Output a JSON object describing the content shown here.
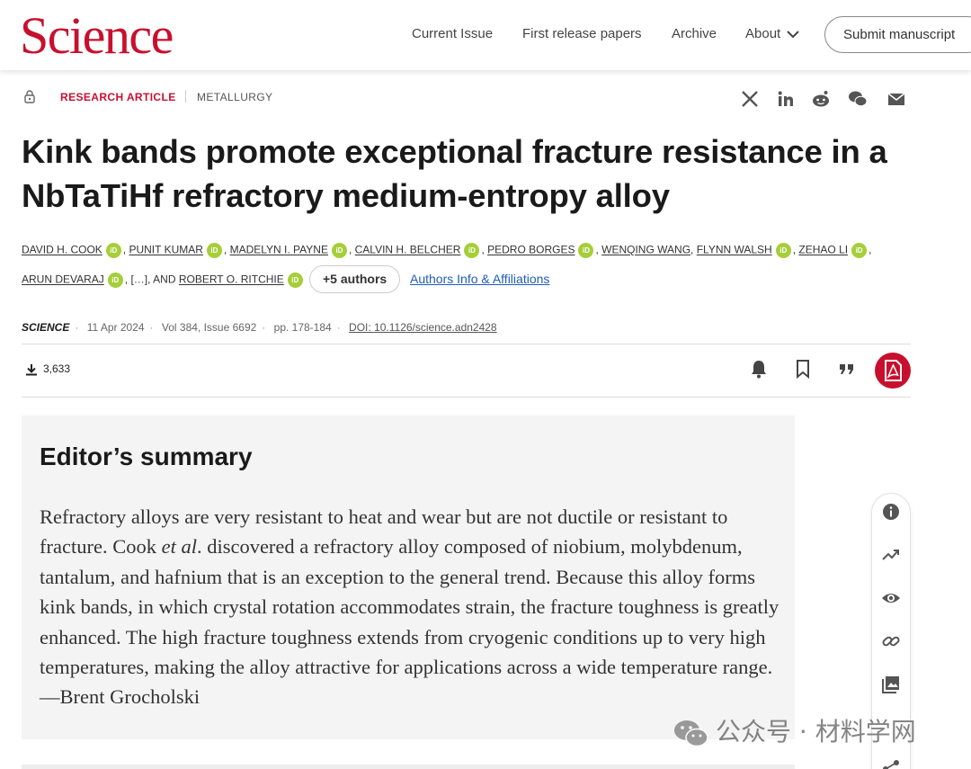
{
  "header": {
    "logo": "Science",
    "nav": [
      "Current Issue",
      "First release papers",
      "Archive",
      "About"
    ],
    "submit_label": "Submit manuscript"
  },
  "article": {
    "type": "RESEARCH ARTICLE",
    "subject": "METALLURGY",
    "title": "Kink bands promote exceptional fracture resistance in a NbTaTiHf refractory medium-entropy alloy",
    "authors_line1": [
      "DAVID H. COOK",
      "PUNIT KUMAR",
      "MADELYN I. PAYNE",
      "CALVIN H. BELCHER",
      "PEDRO BORGES",
      "WENQING WANG",
      "FLYNN WALSH",
      "ZEHAO LI"
    ],
    "authors_line2_first": "ARUN DEVARAJ",
    "authors_ellipsis": "[…], AND",
    "authors_last": "ROBERT O. RITCHIE",
    "orcid_label": "iD",
    "more_authors": "+5 authors",
    "affiliations_link": "Authors Info & Affiliations",
    "journal": "SCIENCE",
    "date": "11 Apr 2024",
    "volume": "Vol 384, Issue 6692",
    "pages": "pp. 178-184",
    "doi": "DOI: 10.1126/science.adn2428",
    "downloads": "3,633"
  },
  "summary": {
    "heading": "Editor’s summary",
    "text_before_italic": "Refractory alloys are very resistant to heat and wear but are not ductile or resistant to fracture. Cook ",
    "text_italic": "et al",
    "text_after_italic": ". discovered a refractory alloy composed of niobium, molyb­denum, tantalum, and hafnium that is an exception to the general trend. Because this alloy forms kink bands, in which crystal rotation accommodates strain, the fracture toughness is greatly enhanced. The high fracture toughness extends from cryogenic conditions up to very high temperatures, making the alloy attractive for applications across a wide temperature range. —Brent Grocholski"
  },
  "watermark": "公众号 · 材料学网",
  "icons": {
    "share": [
      "x-icon",
      "linkedin-icon",
      "reddit-icon",
      "wechat-icon",
      "email-icon"
    ],
    "actions": [
      "bell-icon",
      "bookmark-icon",
      "quote-icon",
      "pdf-icon"
    ],
    "side": [
      "info-icon",
      "trending-icon",
      "eye-icon",
      "link-icon",
      "image-icon",
      "share-icon"
    ]
  },
  "colors": {
    "brand": "#c8102e",
    "orcid": "#a6ce39",
    "link": "#1f5db5"
  }
}
